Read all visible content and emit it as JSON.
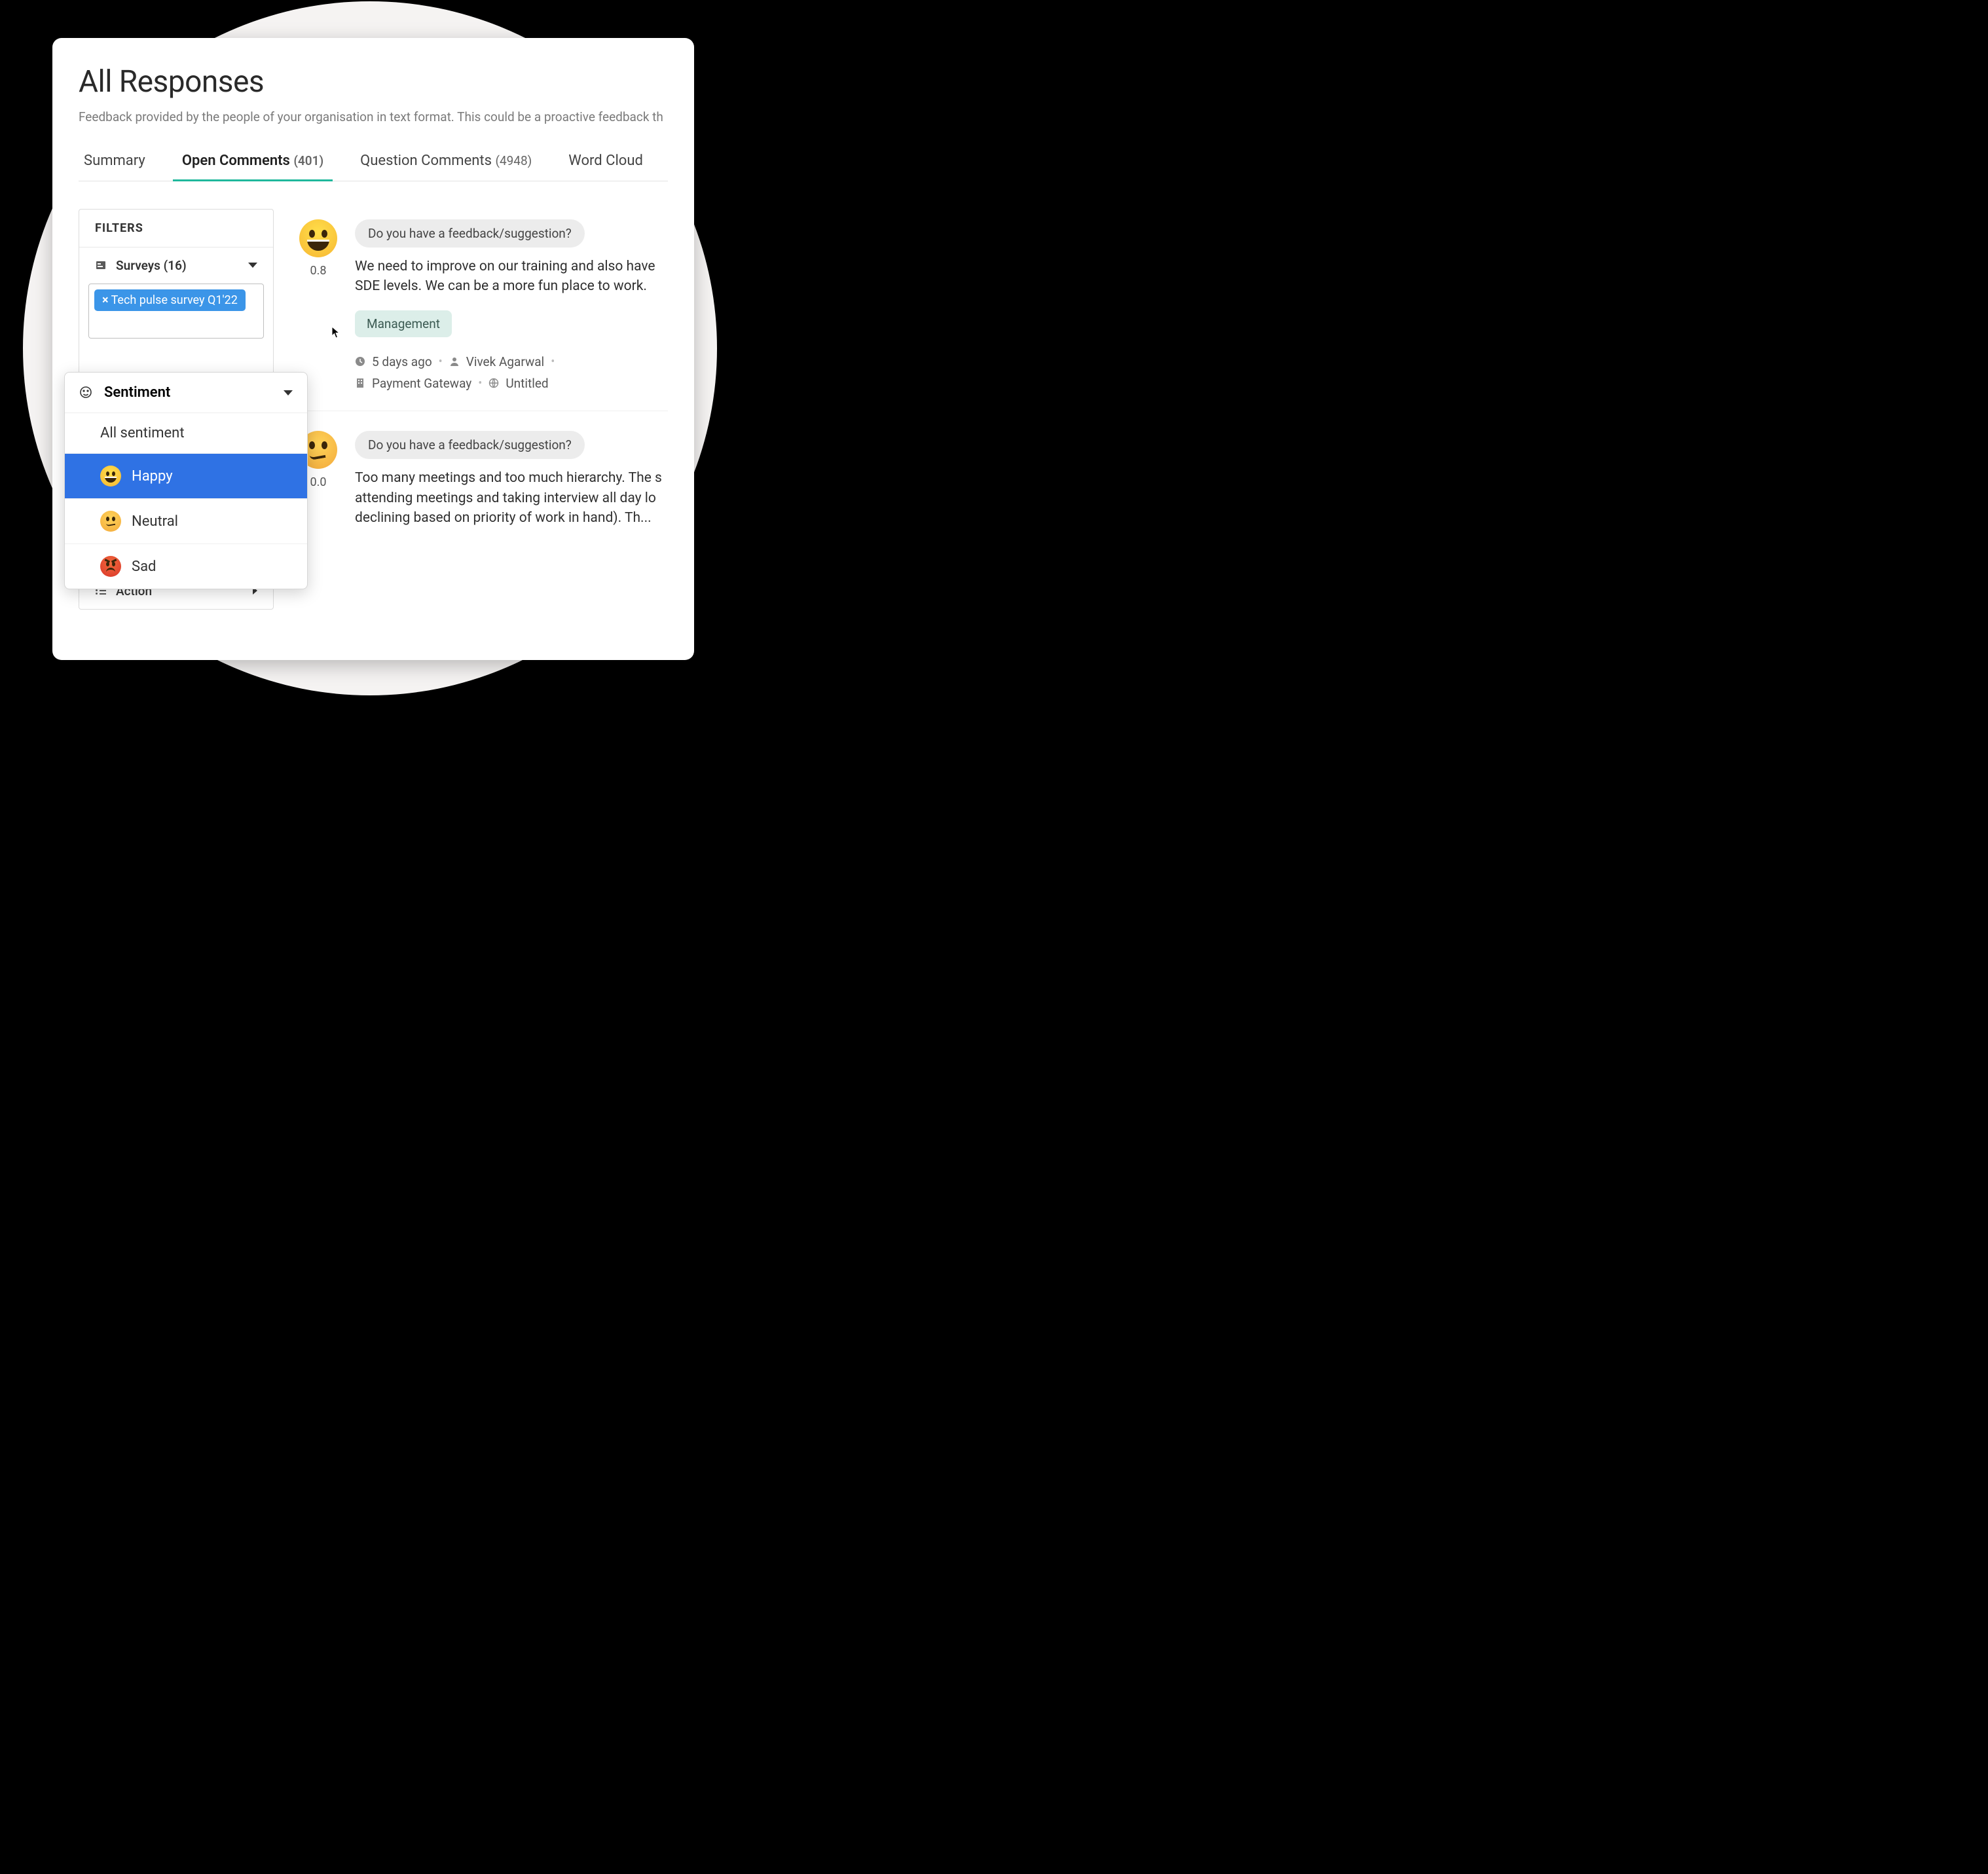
{
  "header": {
    "title": "All Responses",
    "subtitle": "Feedback provided by the people of your organisation in text format. This could be a proactive feedback th"
  },
  "tabs": {
    "summary": "Summary",
    "open": {
      "label": "Open Comments",
      "count": "(401)"
    },
    "question": {
      "label": "Question Comments",
      "count": "(4948)"
    },
    "wordcloud": "Word Cloud"
  },
  "filters": {
    "heading": "FILTERS",
    "surveys": {
      "label": "Surveys (16)"
    },
    "chip": {
      "label": "Tech pulse survey Q1'22"
    },
    "action": {
      "label": "Action"
    }
  },
  "sentiment_popover": {
    "title": "Sentiment",
    "options": {
      "all": "All sentiment",
      "happy": "Happy",
      "neutral": "Neutral",
      "sad": "Sad"
    }
  },
  "comments": [
    {
      "score": "0.8",
      "prompt": "Do you have a feedback/suggestion?",
      "text": "We need to improve on our training and also have SDE levels. We can be a more fun place to work.",
      "tag": "Management",
      "meta": {
        "time": "5 days ago",
        "author": "Vivek Agarwal",
        "dept": "Payment Gateway",
        "extra": "Untitled"
      }
    },
    {
      "score": "0.0",
      "prompt": "Do you have a feedback/suggestion?",
      "text": "Too many meetings and too much hierarchy. The s attending meetings and taking interview all day lo declining based on priority of work in hand). Th..."
    }
  ]
}
